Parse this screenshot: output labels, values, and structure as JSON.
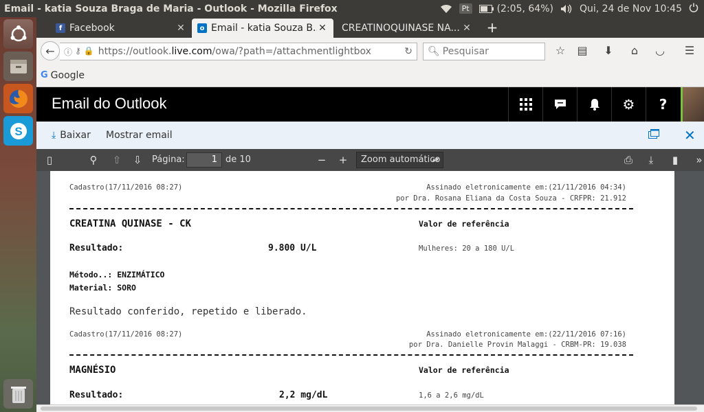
{
  "os": {
    "window_title": "Email - katia Souza Braga de Maria - Outlook - Mozilla Firefox",
    "keyboard_layout": "Pt",
    "battery": "(2:05, 64%)",
    "clock": "Qui, 24 de Nov 10:45"
  },
  "browser": {
    "tabs": [
      {
        "label": "Facebook"
      },
      {
        "label": "Email - katia Souza B..."
      },
      {
        "label": "CREATINOQUINASE NA..."
      }
    ],
    "url_prefix": "https://outlook.",
    "url_host": "live.com",
    "url_path": "/owa/?path=/attachmentlightbox",
    "search_placeholder": "Pesquisar",
    "bookmark_google": "Google"
  },
  "outlook": {
    "app_title": "Email do Outlook",
    "download_label": "Baixar",
    "show_email_label": "Mostrar email"
  },
  "pdf_viewer": {
    "page_label": "Página:",
    "page_current": "1",
    "page_total": "de 10",
    "zoom": "Zoom automático"
  },
  "document": {
    "block1": {
      "registered": "Cadastro(17/11/2016 08:27)",
      "signed": "Assinado eletronicamente em:(21/11/2016 04:34)",
      "signer": "por Dra. Rosana Eliana da Costa Souza - CRFPR: 21.912",
      "title": "CREATINA QUINASE - CK",
      "ref_header": "Valor de referência",
      "result_label": "Resultado:",
      "result_value": "9.800 U/L",
      "ref_value": "Mulheres: 20 a 180 U/L",
      "method_label": "Método..:",
      "method_value": "ENZIMÁTICO",
      "material_label": "Material:",
      "material_value": "SORO",
      "remark": "Resultado conferido, repetido e liberado."
    },
    "block2": {
      "registered": "Cadastro(17/11/2016 08:27)",
      "signed": "Assinado eletronicamente em:(22/11/2016 07:16)",
      "signer": "por Dra. Danielle Provin Malaggi - CRBM-PR: 19.038",
      "title": "MAGNÉSIO",
      "ref_header": "Valor de referência",
      "result_label": "Resultado:",
      "result_value": "2,2 mg/dL",
      "ref_value": "1,6 a 2,6 mg/dL"
    }
  }
}
